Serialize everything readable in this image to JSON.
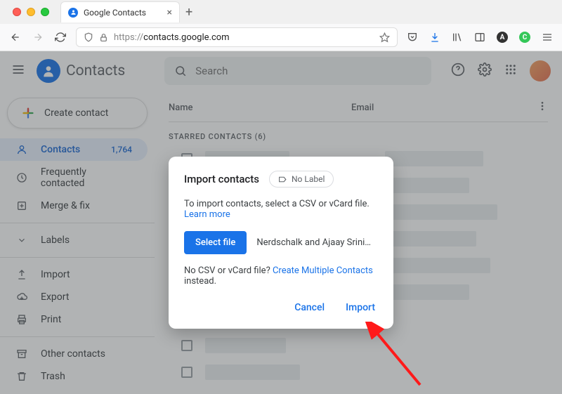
{
  "browser": {
    "tab_title": "Google Contacts",
    "url_prefix": "https://",
    "url_host": "contacts.google.com"
  },
  "header": {
    "app_name": "Contacts",
    "search_placeholder": "Search"
  },
  "sidebar": {
    "create_label": "Create contact",
    "items": [
      {
        "label": "Contacts",
        "count": "1,764"
      },
      {
        "label": "Frequently contacted"
      },
      {
        "label": "Merge & fix"
      },
      {
        "label": "Labels"
      },
      {
        "label": "Import"
      },
      {
        "label": "Export"
      },
      {
        "label": "Print"
      },
      {
        "label": "Other contacts"
      },
      {
        "label": "Trash"
      }
    ]
  },
  "table": {
    "col_name": "Name",
    "col_email": "Email",
    "section_label": "STARRED CONTACTS (6)"
  },
  "dialog": {
    "title": "Import contacts",
    "no_label": "No Label",
    "body_prefix": "To import contacts, select a CSV or vCard file.",
    "learn_more": "Learn more",
    "select_file": "Select file",
    "file_name": "Nerdschalk and Ajaay Srini…",
    "alt_prefix": "No CSV or vCard file?",
    "alt_link": "Create Multiple Contacts",
    "alt_suffix": "instead.",
    "cancel": "Cancel",
    "import": "Import"
  }
}
